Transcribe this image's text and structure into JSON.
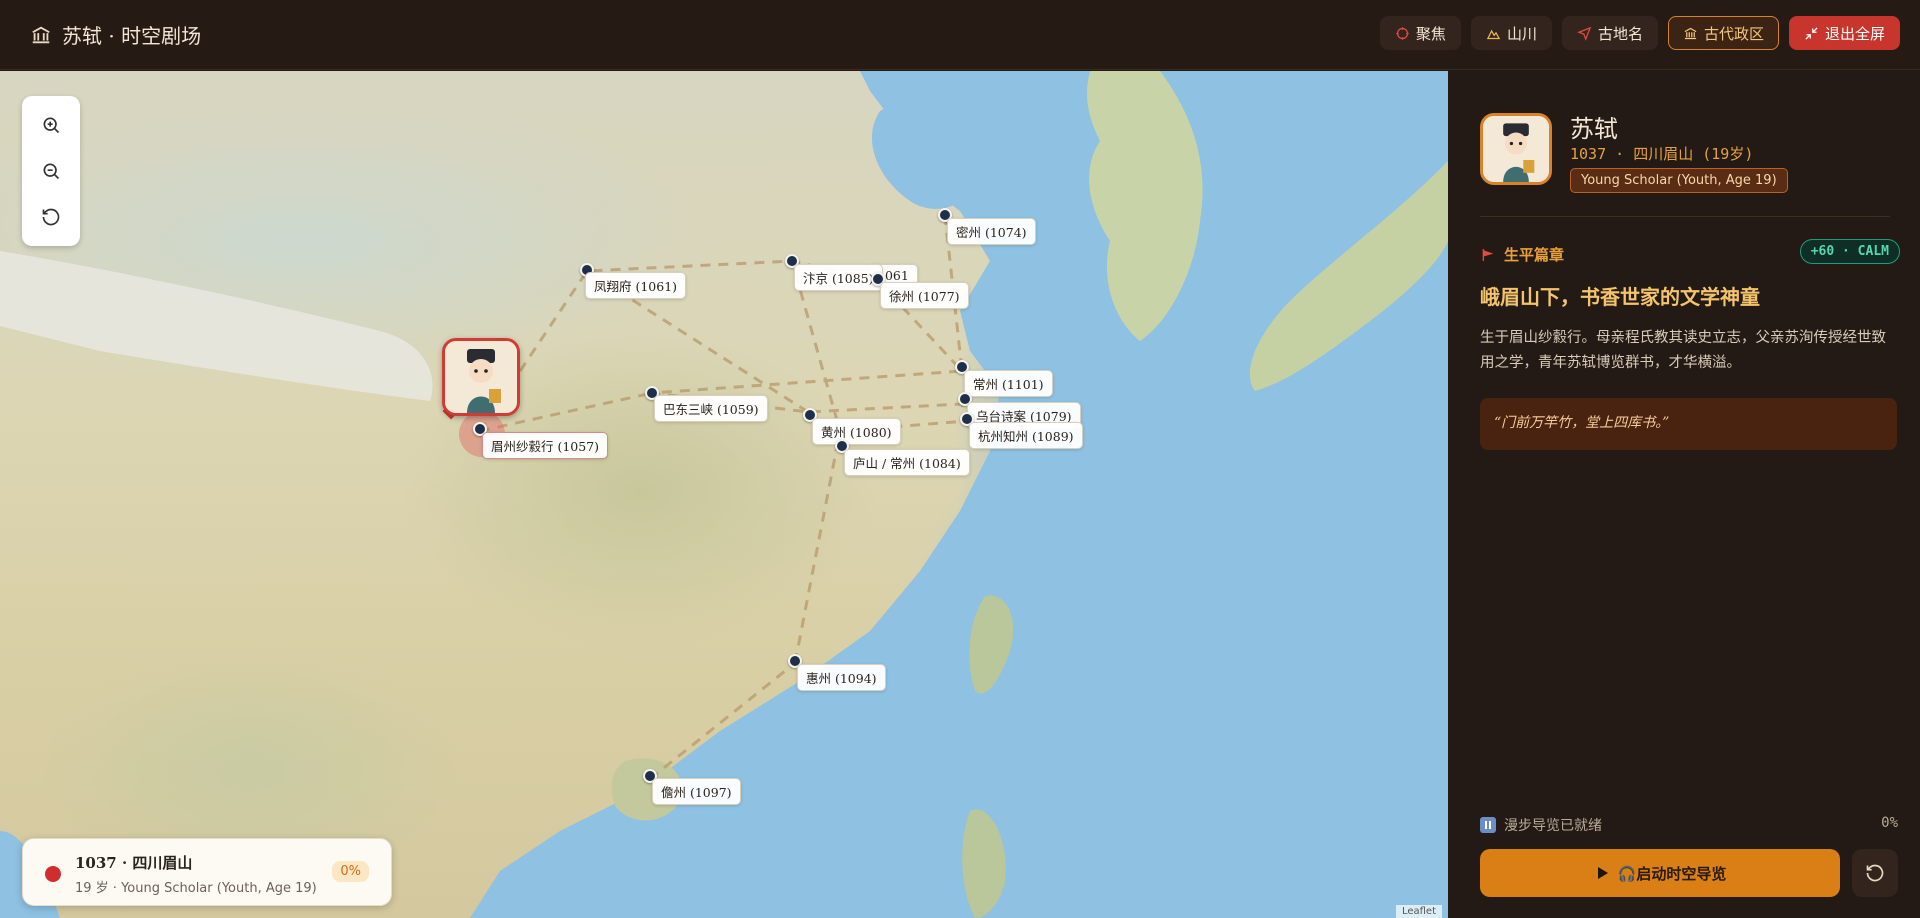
{
  "app": {
    "title": "苏轼 · 时空剧场"
  },
  "toolbar": {
    "focus_label": "聚焦",
    "mountains_label": "山川",
    "ancient_names_label": "古地名",
    "ancient_districts_label": "古代政区",
    "exit_fullscreen_label": "退出全屏"
  },
  "map": {
    "places": [
      {
        "name": "眉州纱縠行 (1057)",
        "active": true
      },
      {
        "name": "凤翔府 (1061)"
      },
      {
        "name": "汴京 (1085)"
      },
      {
        "name": "1061"
      },
      {
        "name": "徐州 (1077)"
      },
      {
        "name": "密州 (1074)"
      },
      {
        "name": "巴东三峡 (1059)"
      },
      {
        "name": "黄州 (1080)"
      },
      {
        "name": "庐山 / 常州 (1084)"
      },
      {
        "name": "常州 (1101)"
      },
      {
        "name": "乌台诗案 (1079)"
      },
      {
        "name": "杭州知州 (1089)"
      },
      {
        "name": "惠州 (1094)"
      },
      {
        "name": "儋州 (1097)"
      }
    ],
    "status_card": {
      "title": "1037 · 四川眉山",
      "subtitle": "19 岁 · Young Scholar (Youth, Age 19)",
      "progress": "0%"
    },
    "attribution": "Leaflet"
  },
  "profile": {
    "name": "苏轼",
    "meta": "1037 · 四川眉山 (19岁)",
    "badge": "Young Scholar (Youth, Age 19)"
  },
  "chapter": {
    "tag": "生平篇章",
    "calm": "+60 · CALM",
    "title": "峨眉山下，书香世家的文学神童",
    "body": "生于眉山纱縠行。母亲程氏教其读史立志，父亲苏洵传授经世致用之学，青年苏轼博览群书，才华横溢。",
    "quote": "“门前万竿竹，堂上四库书。”"
  },
  "guide": {
    "status": "漫步导览已就绪",
    "progress": "0%",
    "start_label": "🎧启动时空导览"
  },
  "colors": {
    "accent": "#d97f16",
    "danger": "#c7352c",
    "calm": "#56d6ad",
    "marker": "#1e2f4c"
  }
}
